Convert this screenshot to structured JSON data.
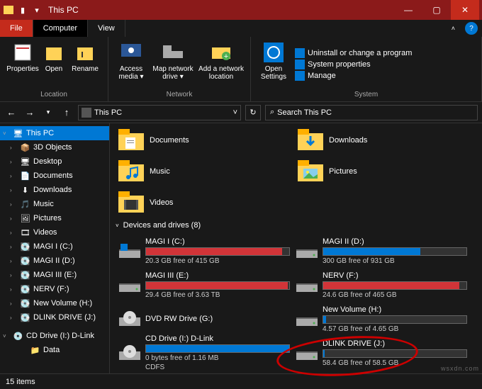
{
  "titlebar": {
    "title": "This PC"
  },
  "tabs": {
    "file": "File",
    "computer": "Computer",
    "view": "View"
  },
  "ribbon": {
    "location": {
      "label": "Location",
      "properties": "Properties",
      "open": "Open",
      "rename": "Rename"
    },
    "network": {
      "label": "Network",
      "access": "Access media ▾",
      "map": "Map network drive ▾",
      "add": "Add a network location"
    },
    "system": {
      "label": "System",
      "open": "Open Settings",
      "uninstall": "Uninstall or change a program",
      "sysprops": "System properties",
      "manage": "Manage"
    }
  },
  "address": {
    "path": "This PC",
    "search": "Search This PC"
  },
  "sidebar": {
    "thispc": "This PC",
    "items": [
      "3D Objects",
      "Desktop",
      "Documents",
      "Downloads",
      "Music",
      "Pictures",
      "Videos",
      "MAGI I (C:)",
      "MAGI II (D:)",
      "MAGI III (E:)",
      "NERV (F:)",
      "New Volume (H:)",
      "DLINK DRIVE (J:)"
    ],
    "cd": "CD Drive (I:) D-Link",
    "data": "Data"
  },
  "folders": [
    "Documents",
    "Downloads",
    "Music",
    "Pictures",
    "Videos"
  ],
  "section": "Devices and drives (8)",
  "drives": [
    {
      "name": "MAGI I (C:)",
      "free": "20.3 GB free of 415 GB",
      "pct": 95,
      "color": "red",
      "type": "os"
    },
    {
      "name": "MAGI II (D:)",
      "free": "300 GB free of 931 GB",
      "pct": 68,
      "color": "blue",
      "type": "hdd"
    },
    {
      "name": "MAGI III (E:)",
      "free": "29.4 GB free of 3.63 TB",
      "pct": 99,
      "color": "red",
      "type": "hdd"
    },
    {
      "name": "NERV (F:)",
      "free": "24.6 GB free of 465 GB",
      "pct": 95,
      "color": "red",
      "type": "hdd"
    },
    {
      "name": "DVD RW Drive (G:)",
      "free": "",
      "pct": 0,
      "color": "",
      "type": "dvd"
    },
    {
      "name": "New Volume (H:)",
      "free": "4.57 GB free of 4.65 GB",
      "pct": 2,
      "color": "blue",
      "type": "hdd"
    },
    {
      "name": "CD Drive (I:) D-Link",
      "free": "0 bytes free of 1.16 MB",
      "sub": "CDFS",
      "pct": 100,
      "color": "blue",
      "type": "cd"
    },
    {
      "name": "DLINK DRIVE (J:)",
      "free": "58.4 GB free of 58.5 GB",
      "pct": 1,
      "color": "blue",
      "type": "hdd"
    }
  ],
  "status": "15 items",
  "watermark": "wsxdn.com"
}
